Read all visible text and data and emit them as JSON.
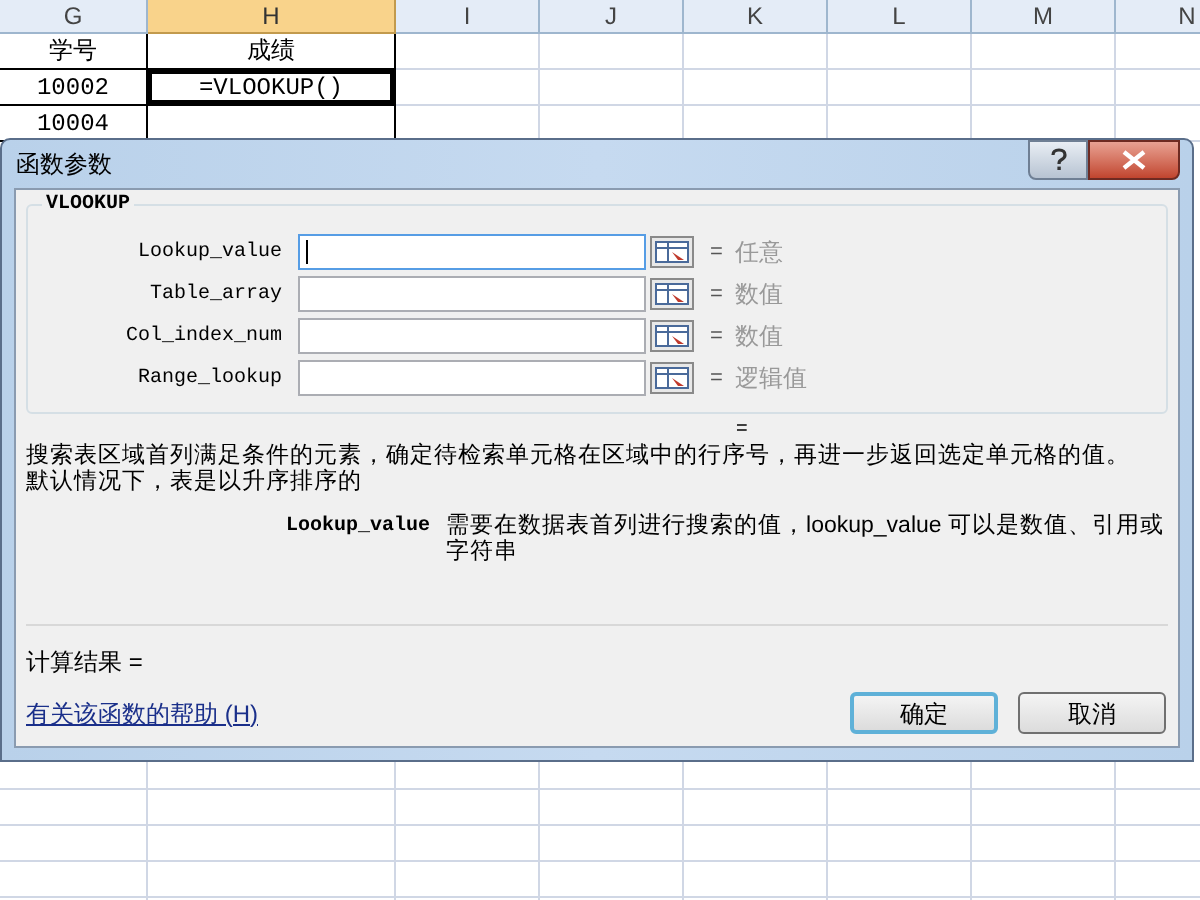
{
  "sheet": {
    "columns": [
      {
        "label": "G",
        "selected": false
      },
      {
        "label": "H",
        "selected": true
      },
      {
        "label": "I",
        "selected": false
      },
      {
        "label": "J",
        "selected": false
      },
      {
        "label": "K",
        "selected": false
      },
      {
        "label": "L",
        "selected": false
      },
      {
        "label": "M",
        "selected": false
      },
      {
        "label": "N",
        "selected": false
      }
    ],
    "rows": [
      {
        "cells": [
          {
            "text": "学号",
            "selected": false
          },
          {
            "text": "成绩",
            "selected": false
          }
        ]
      },
      {
        "cells": [
          {
            "text": "10002",
            "selected": false
          },
          {
            "text": "=VLOOKUP()",
            "selected": true
          }
        ]
      },
      {
        "cells": [
          {
            "text": "10004",
            "selected": false
          }
        ]
      }
    ]
  },
  "dialog": {
    "title": "函数参数",
    "function_name": "VLOOKUP",
    "arguments": [
      {
        "name": "Lookup_value",
        "hint": "任意",
        "focused": true
      },
      {
        "name": "Table_array",
        "hint": "数值",
        "focused": false
      },
      {
        "name": "Col_index_num",
        "hint": "数值",
        "focused": false
      },
      {
        "name": "Range_lookup",
        "hint": "逻辑值",
        "focused": false
      }
    ],
    "equals": "=",
    "arg_equals": "=",
    "description": "搜索表区域首列满足条件的元素，确定待检索单元格在区域中的行序号，再进一步返回选定单元格的值。默认情况下，表是以升序排序的",
    "param_name": "Lookup_value",
    "param_description": "需要在数据表首列进行搜索的值，lookup_value 可以是数值、引用或字符串",
    "result_label": "计算结果 =",
    "help_link": "有关该函数的帮助 (H)",
    "buttons": [
      {
        "label": "确定",
        "default": true
      },
      {
        "label": "取消",
        "default": false
      }
    ]
  }
}
